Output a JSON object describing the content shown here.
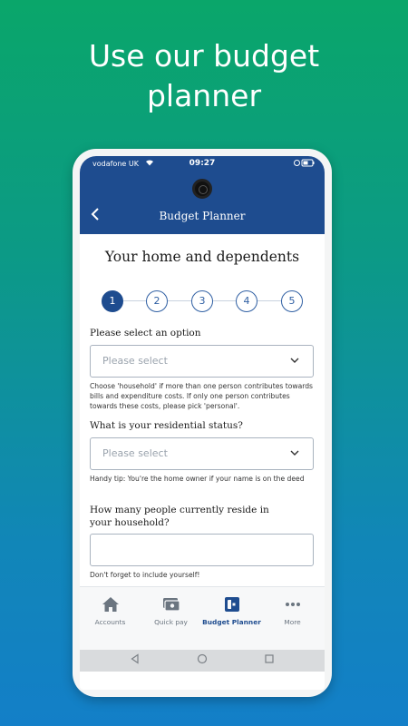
{
  "headline": {
    "line1": "Use our budget",
    "line2": "planner"
  },
  "statusbar": {
    "carrier": "vodafone UK",
    "time": "09:27"
  },
  "appbar": {
    "title": "Budget Planner"
  },
  "page": {
    "title": "Your home and dependents",
    "steps": [
      "1",
      "2",
      "3",
      "4",
      "5"
    ],
    "active_step": 1
  },
  "form": {
    "option": {
      "label": "Please select an option",
      "placeholder": "Please select",
      "help": "Choose 'household' if more than one person contributes towards bills and expenditure costs. If only one person contributes towards these costs, please pick 'personal'."
    },
    "residential": {
      "label": "What is your residential status?",
      "placeholder": "Please select",
      "help": "Handy tip: You're the home owner if your name is on the deed"
    },
    "people": {
      "label_line1": "How many people currently reside in",
      "label_line2": "your household?",
      "value": "",
      "help": "Don't forget to include yourself!"
    }
  },
  "tabbar": {
    "tabs": [
      {
        "label": "Accounts",
        "icon": "home-icon"
      },
      {
        "label": "Quick pay",
        "icon": "quick-pay-icon"
      },
      {
        "label": "Budget Planner",
        "icon": "budget-planner-icon"
      },
      {
        "label": "More",
        "icon": "more-dots-icon"
      }
    ],
    "active": "Budget Planner"
  },
  "colors": {
    "brand": "#1e4c8f",
    "background_top": "#0aa66a",
    "background_bottom": "#137fc8"
  }
}
